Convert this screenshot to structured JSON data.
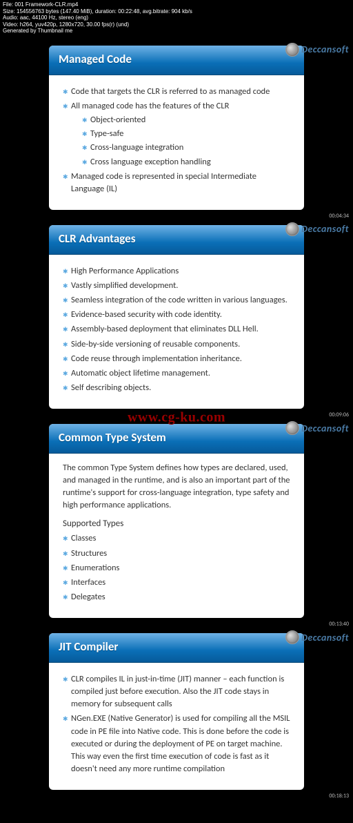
{
  "meta": {
    "line1": "File: 001 Framework-CLR.mp4",
    "line2": "Size: 154556763 bytes (147.40 MiB), duration: 00:22:48, avg.bitrate: 904 kb/s",
    "line3": "Audio: aac, 44100 Hz, stereo (eng)",
    "line4": "Video: h264, yuv420p, 1280x720, 30.00 fps(r) (und)",
    "line5": "Generated by Thumbnail me"
  },
  "logo_text": "Deccansoft",
  "watermark": "www.cg-ku.com",
  "slides": [
    {
      "title": "Managed Code",
      "timestamp": "00:04:34",
      "bullets": [
        {
          "text": "Code that targets the CLR is referred to as managed code"
        },
        {
          "text": "All managed code has the features of the CLR",
          "sub": [
            "Object-oriented",
            "Type-safe",
            "Cross-language integration",
            "Cross language exception handling"
          ]
        },
        {
          "text": "Managed code is represented in special Intermediate Language (IL)"
        }
      ]
    },
    {
      "title": "CLR Advantages",
      "timestamp": "00:09:06",
      "bullets": [
        {
          "text": "High Performance Applications"
        },
        {
          "text": "Vastly simplified development."
        },
        {
          "text": "Seamless integration of the code written in various languages."
        },
        {
          "text": "Evidence-based security with code identity."
        },
        {
          "text": "Assembly-based deployment that eliminates DLL Hell."
        },
        {
          "text": "Side-by-side versioning of reusable components."
        },
        {
          "text": "Code reuse through implementation inheritance."
        },
        {
          "text": "Automatic object lifetime management."
        },
        {
          "text": "Self describing objects."
        }
      ]
    },
    {
      "title": "Common Type System",
      "timestamp": "00:13:40",
      "para": "The common Type System defines how types are declared, used, and managed in the runtime, and is also an important part of the runtime's support for cross-language integration, type safety and high performance applications.",
      "subheading": "Supported Types",
      "bullets": [
        {
          "text": "Classes"
        },
        {
          "text": "Structures"
        },
        {
          "text": "Enumerations"
        },
        {
          "text": "Interfaces"
        },
        {
          "text": "Delegates"
        }
      ]
    },
    {
      "title": "JIT Compiler",
      "timestamp": "00:18:13",
      "bullets": [
        {
          "text": "CLR compiles IL in just-in-time (JIT) manner – each function is compiled just before execution. Also the JIT code stays in memory for subsequent calls"
        },
        {
          "text": "NGen.EXE (Native Generator) is used for compiling all the MSIL code in PE file into Native code. This is done before the code is executed or during the deployment of PE on target machine. This way even the first time execution of code is fast as it doesn't need any more runtime compilation"
        }
      ]
    }
  ]
}
